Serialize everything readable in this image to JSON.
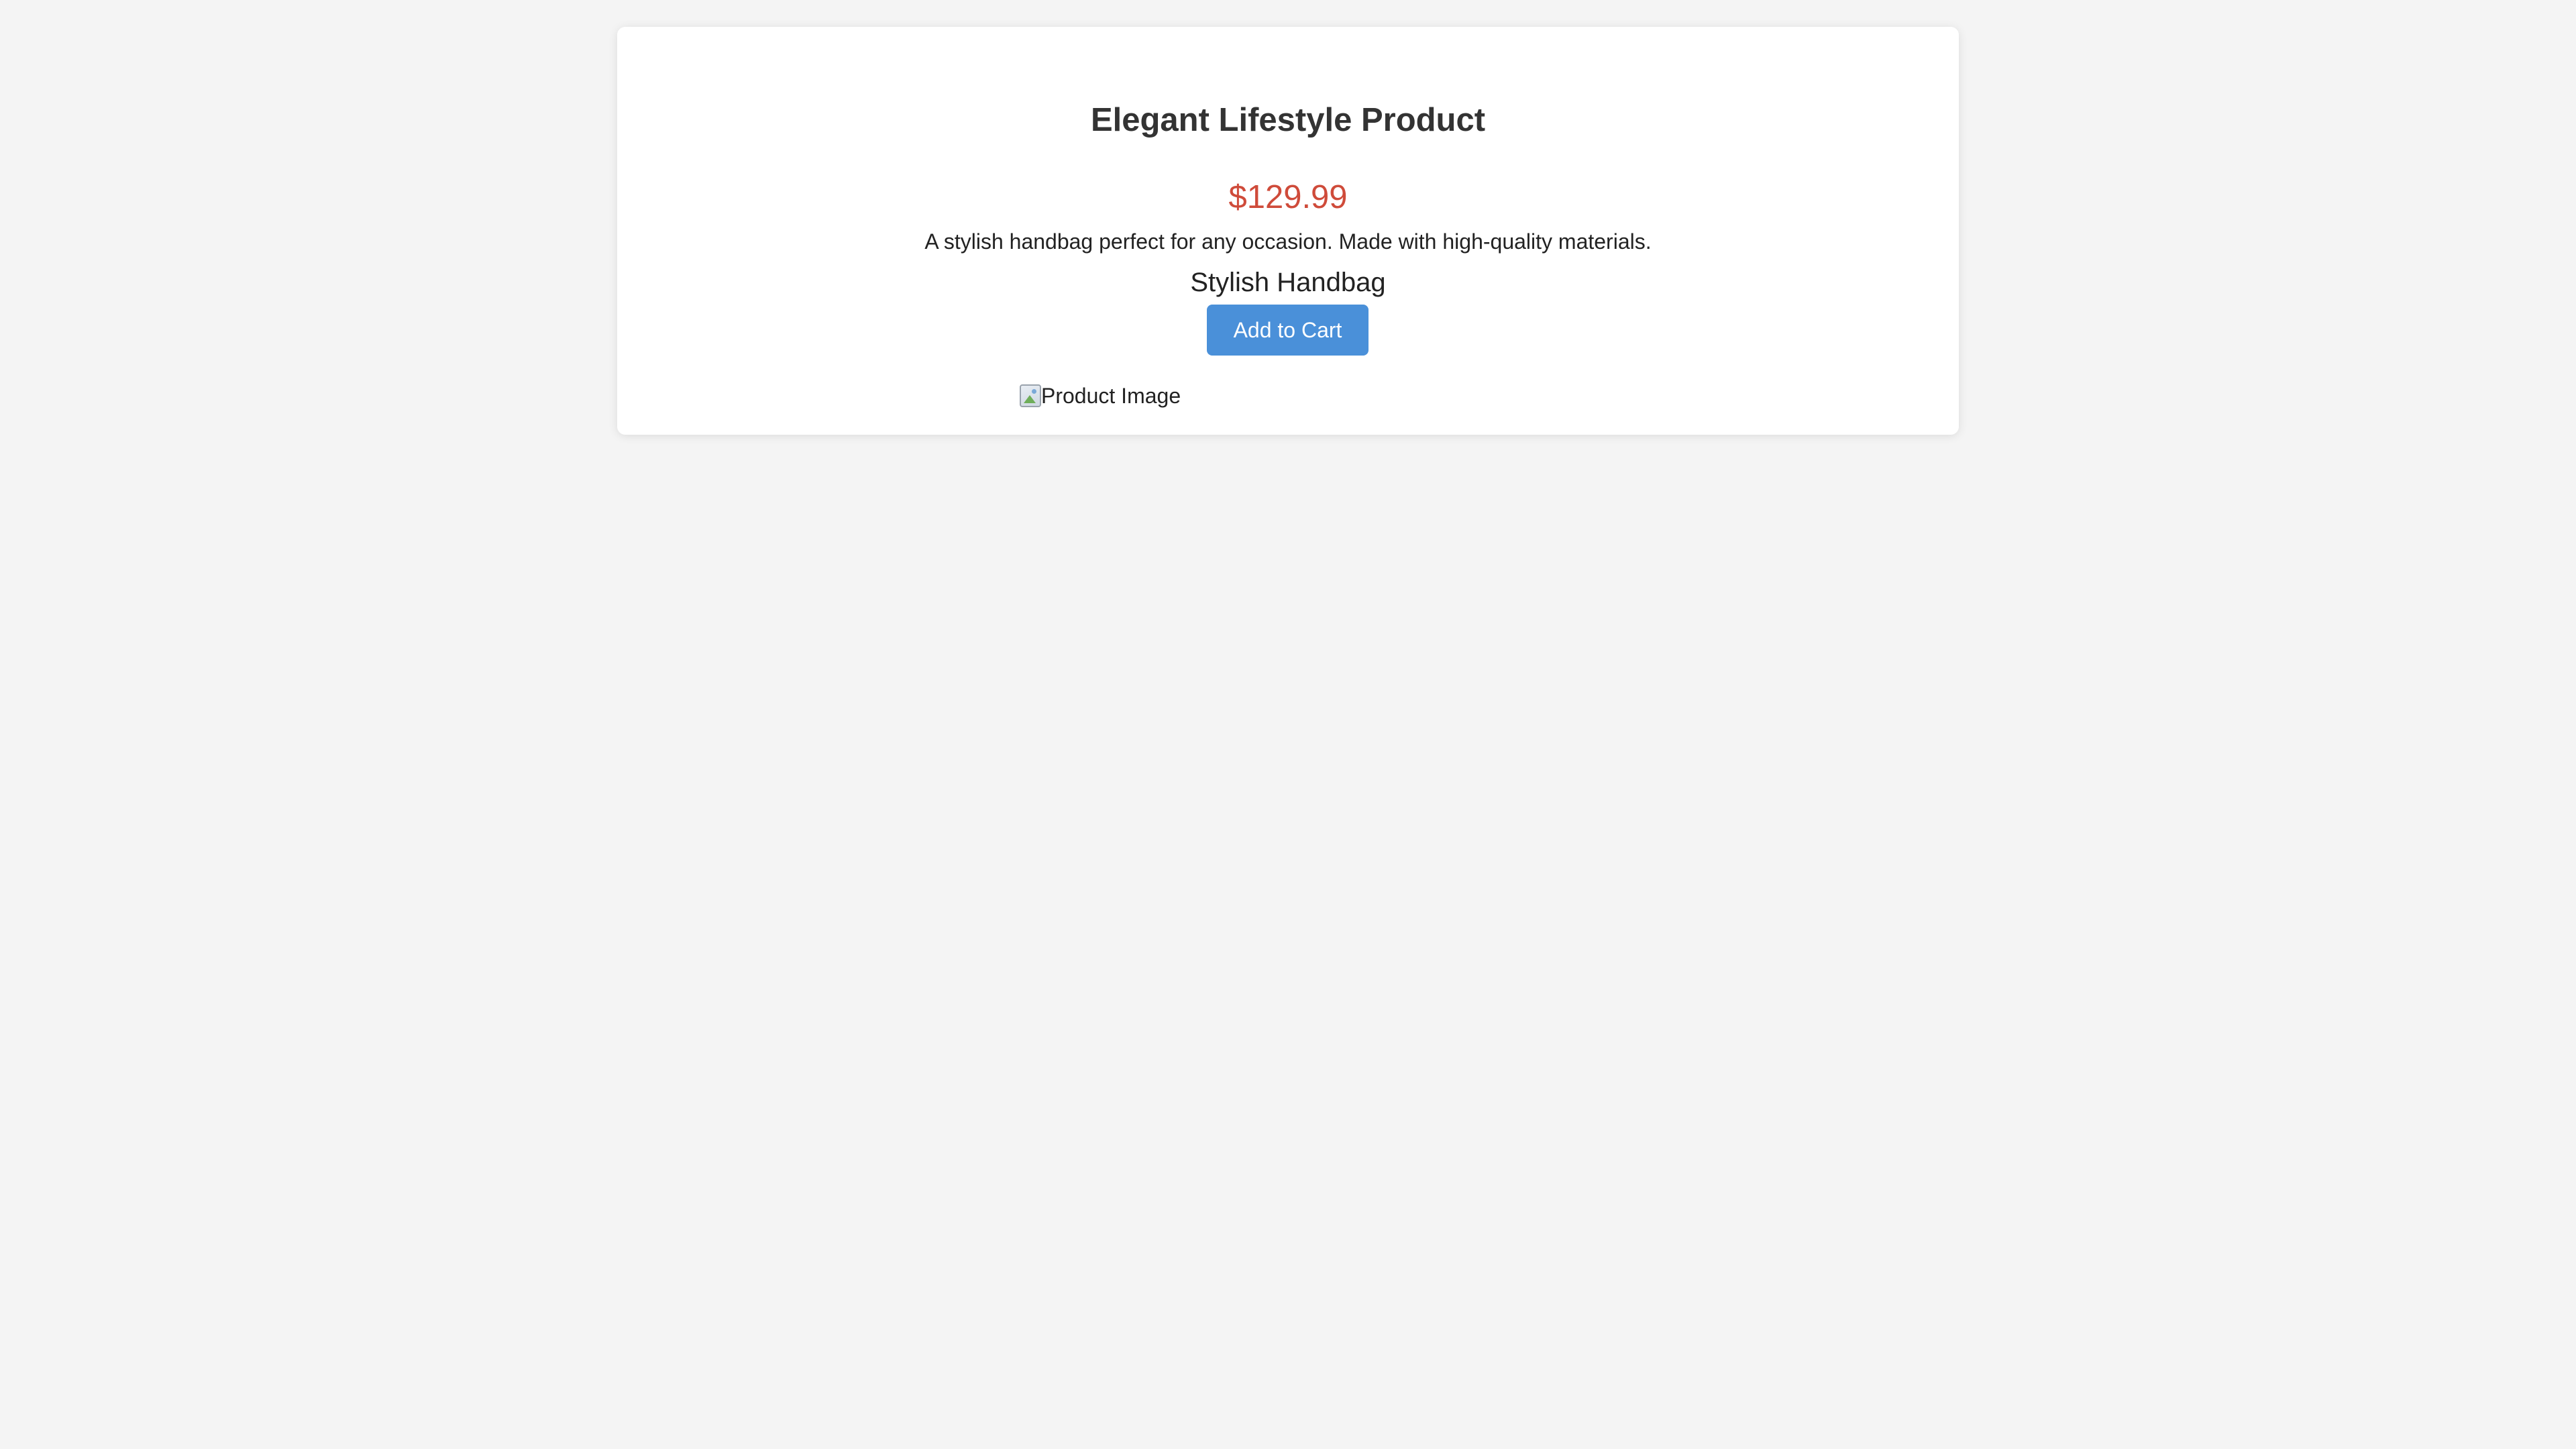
{
  "product": {
    "title": "Elegant Lifestyle Product",
    "price": "$129.99",
    "description": "A stylish handbag perfect for any occasion. Made with high-quality materials.",
    "name": "Stylish Handbag",
    "add_to_cart_label": "Add to Cart",
    "image_alt": "Product Image",
    "image_icon": "broken-image-icon"
  },
  "colors": {
    "background": "#f4f4f4",
    "card": "#ffffff",
    "price": "#cf4b3a",
    "button": "#4a90d9",
    "button_text": "#ffffff",
    "title": "#333333"
  }
}
